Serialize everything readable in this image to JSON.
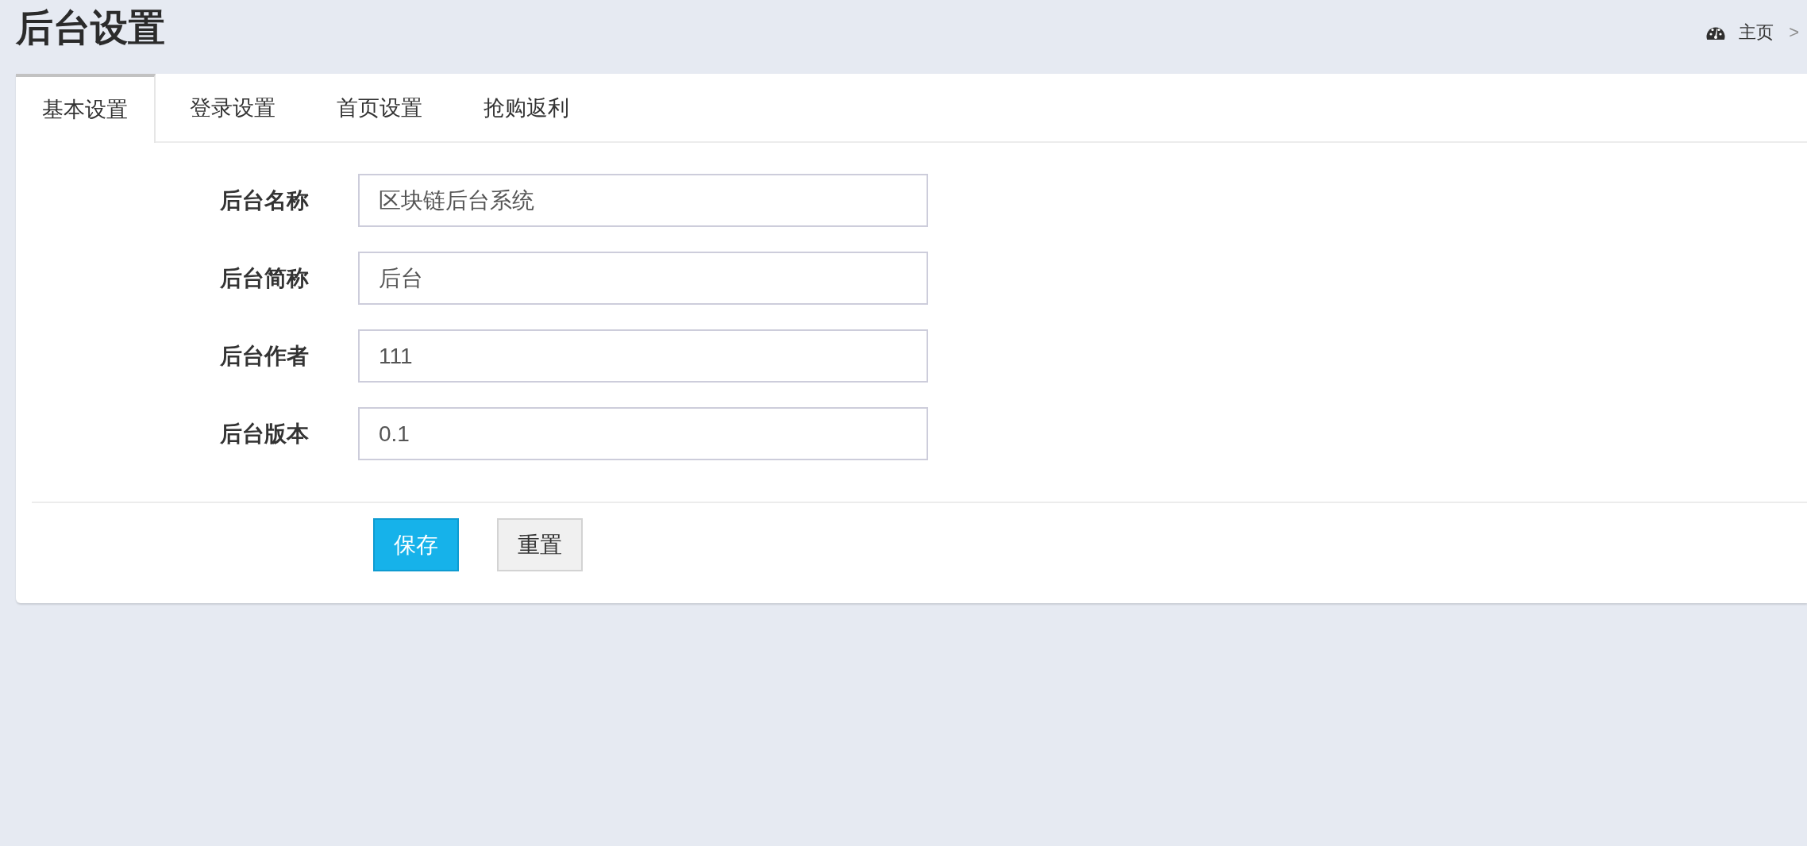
{
  "page": {
    "title": "后台设置"
  },
  "breadcrumb": {
    "home": "主页",
    "separator": ">"
  },
  "tabs": [
    {
      "label": "基本设置",
      "selected": true
    },
    {
      "label": "登录设置",
      "selected": false
    },
    {
      "label": "首页设置",
      "selected": false
    },
    {
      "label": "抢购返利",
      "selected": false
    }
  ],
  "form": {
    "fields": [
      {
        "label": "后台名称",
        "value": "区块链后台系统"
      },
      {
        "label": "后台简称",
        "value": "后台"
      },
      {
        "label": "后台作者",
        "value": "111"
      },
      {
        "label": "后台版本",
        "value": "0.1"
      }
    ]
  },
  "buttons": [
    {
      "label": "保存",
      "kind": "primary"
    },
    {
      "label": "重置",
      "kind": "default"
    }
  ]
}
